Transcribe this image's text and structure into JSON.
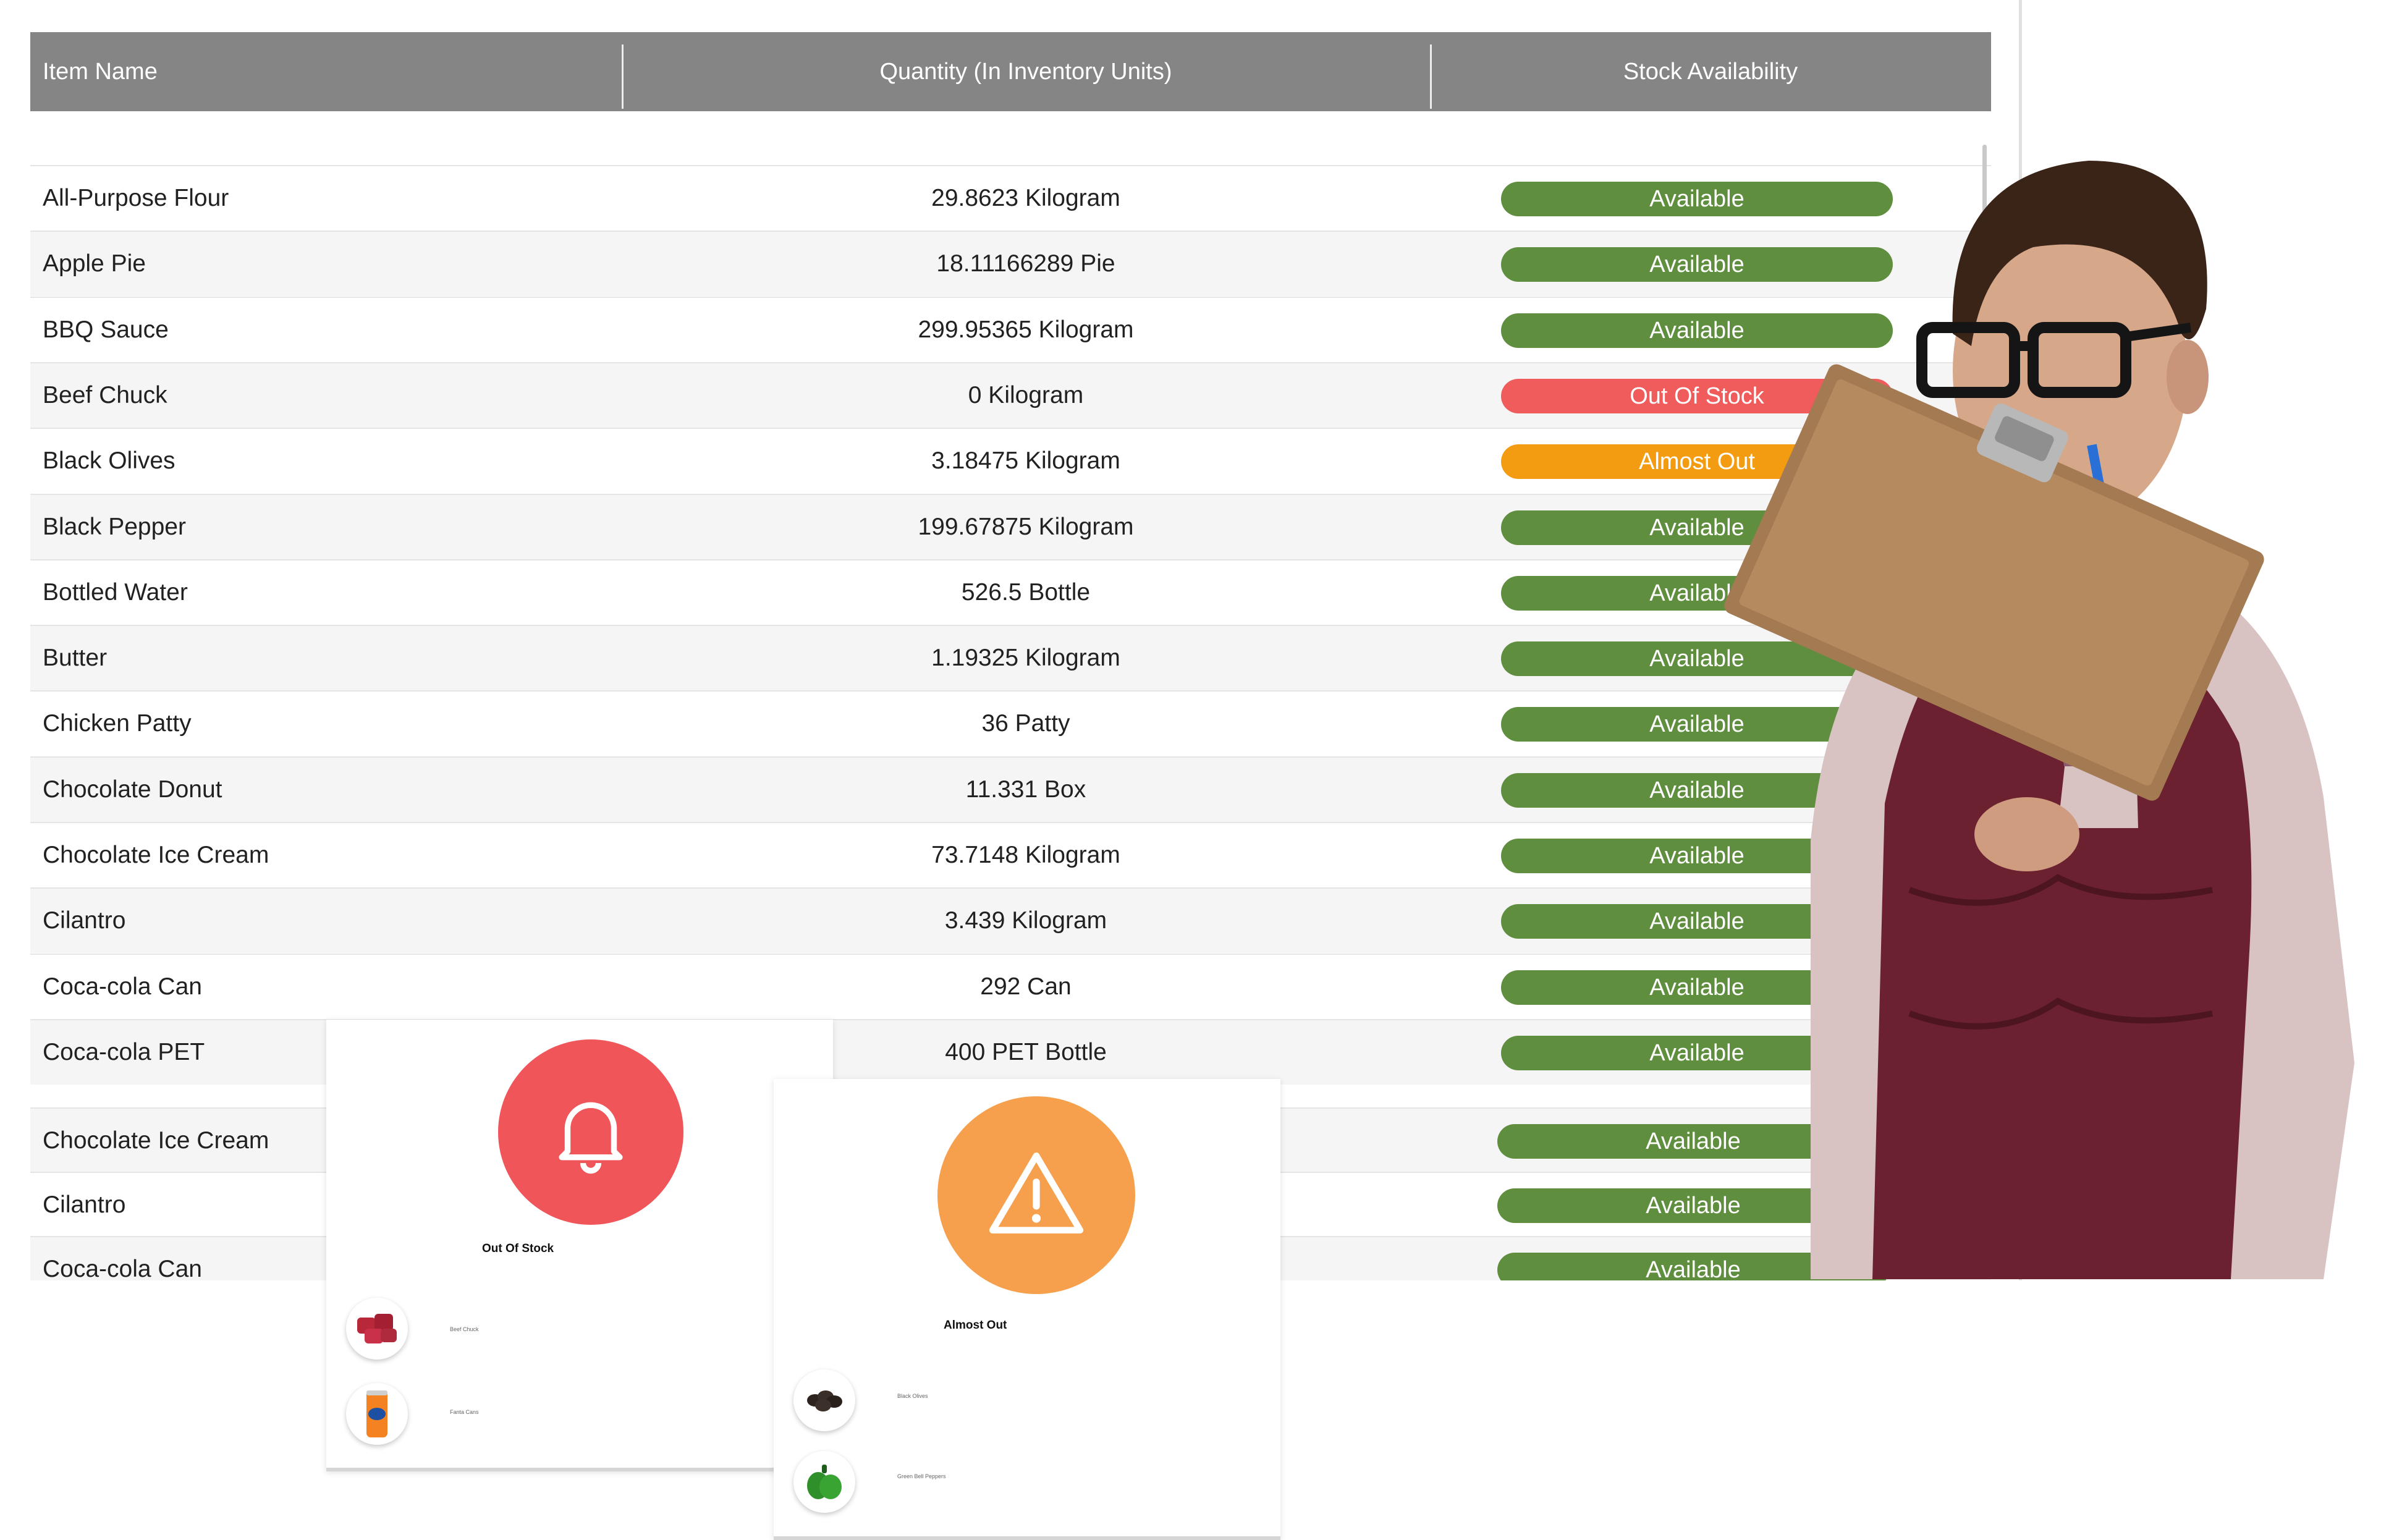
{
  "table": {
    "headers": {
      "name": "Item Name",
      "quantity": "Quantity (In Inventory Units)",
      "stock": "Stock Availability"
    },
    "rows": [
      {
        "name": "All-Purpose Flour",
        "quantity": "29.8623 Kilogram",
        "status": "Available"
      },
      {
        "name": "Apple Pie",
        "quantity": "18.11166289 Pie",
        "status": "Available"
      },
      {
        "name": "BBQ Sauce",
        "quantity": "299.95365 Kilogram",
        "status": "Available"
      },
      {
        "name": "Beef Chuck",
        "quantity": "0 Kilogram",
        "status": "Out Of Stock"
      },
      {
        "name": "Black Olives",
        "quantity": "3.18475 Kilogram",
        "status": "Almost Out"
      },
      {
        "name": "Black Pepper",
        "quantity": "199.67875 Kilogram",
        "status": "Available"
      },
      {
        "name": "Bottled Water",
        "quantity": "526.5 Bottle",
        "status": "Available"
      },
      {
        "name": "Butter",
        "quantity": "1.19325 Kilogram",
        "status": "Available"
      },
      {
        "name": "Chicken Patty",
        "quantity": "36 Patty",
        "status": "Available"
      },
      {
        "name": "Chocolate Donut",
        "quantity": "11.331 Box",
        "status": "Available"
      },
      {
        "name": "Chocolate Ice Cream",
        "quantity": "73.7148 Kilogram",
        "status": "Available"
      },
      {
        "name": "Cilantro",
        "quantity": "3.439 Kilogram",
        "status": "Available"
      },
      {
        "name": "Coca-cola Can",
        "quantity": "292 Can",
        "status": "Available"
      },
      {
        "name": "Coca-cola PET",
        "quantity": "400 PET Bottle",
        "status": "Available"
      }
    ],
    "lower_rows": [
      {
        "name": "Chocolate Ice Cream",
        "status": "Available"
      },
      {
        "name": "Cilantro",
        "status": "Available"
      },
      {
        "name": "Coca-cola Can",
        "status": "Available"
      }
    ]
  },
  "alerts": {
    "out_of_stock": {
      "title": "Out Of Stock",
      "icon": "bell-icon",
      "color": "#f05659",
      "items": [
        {
          "label": "Beef Chuck",
          "icon": "beef-chuck-icon"
        },
        {
          "label": "Fanta Cans",
          "icon": "fanta-can-icon"
        }
      ]
    },
    "almost_out": {
      "title": "Almost Out",
      "icon": "warning-icon",
      "color": "#f6a04d",
      "items": [
        {
          "label": "Black Olives",
          "icon": "black-olives-icon"
        },
        {
          "label": "Green Bell Peppers",
          "icon": "green-pepper-icon"
        }
      ]
    }
  },
  "colors": {
    "header": "#858585",
    "available": "#5e8e3e",
    "out_of_stock": "#f05b5b",
    "almost_out": "#f39c12"
  }
}
